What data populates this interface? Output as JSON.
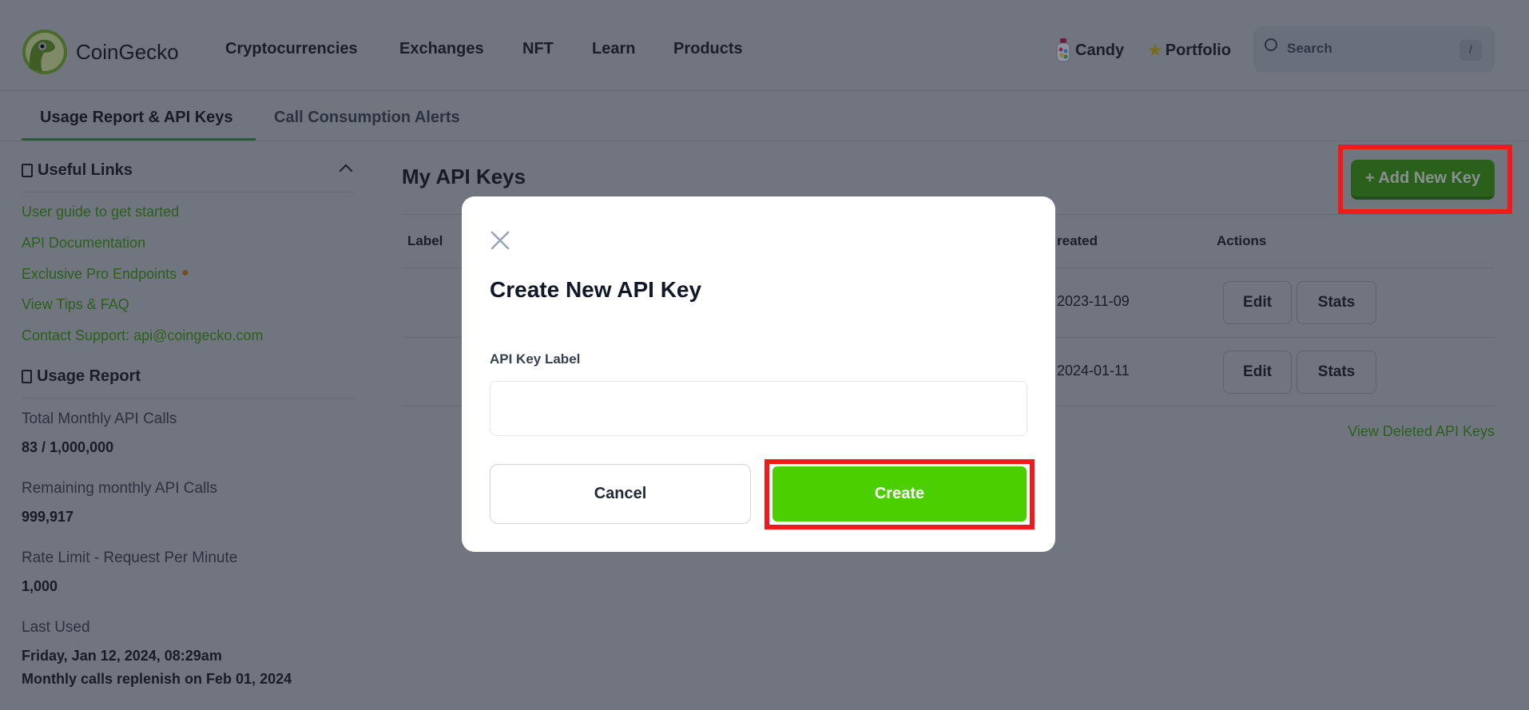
{
  "header": {
    "brand": "CoinGecko",
    "nav": [
      "Cryptocurrencies",
      "Exchanges",
      "NFT",
      "Learn",
      "Products"
    ],
    "candy": "Candy",
    "portfolio": "Portfolio",
    "search_placeholder": "Search",
    "search_shortcut": "/"
  },
  "tabs": [
    {
      "label": "Usage Report & API Keys",
      "active": true
    },
    {
      "label": "Call Consumption Alerts",
      "active": false
    }
  ],
  "sidebar": {
    "useful_links_title": "Useful Links",
    "links": [
      "User guide to get started",
      "API Documentation",
      "Exclusive Pro Endpoints",
      "View Tips & FAQ",
      "Contact Support: api@coingecko.com"
    ],
    "usage_title": "Usage Report",
    "stats": [
      {
        "label": "Total Monthly API Calls",
        "value": "83 / 1,000,000"
      },
      {
        "label": "Remaining monthly API Calls",
        "value": "999,917"
      },
      {
        "label": "Rate Limit - Request Per Minute",
        "value": "1,000"
      },
      {
        "label": "Last Used",
        "value": "Friday, Jan 12, 2024, 08:29am"
      }
    ],
    "replenish": "Monthly calls replenish on Feb 01, 2024"
  },
  "main": {
    "title": "My API Keys",
    "add_button": "+ Add New Key",
    "columns": {
      "label": "Label",
      "created": "reated",
      "actions": "Actions"
    },
    "rows": [
      {
        "created": "2023-11-09",
        "edit": "Edit",
        "stats": "Stats"
      },
      {
        "created": "2024-01-11",
        "edit": "Edit",
        "stats": "Stats"
      }
    ],
    "view_deleted": "View Deleted API Keys"
  },
  "modal": {
    "title": "Create New API Key",
    "field_label": "API Key Label",
    "field_value": "",
    "cancel": "Cancel",
    "create": "Create"
  },
  "colors": {
    "brand_green": "#4bcc00",
    "highlight": "#f21a1a"
  }
}
